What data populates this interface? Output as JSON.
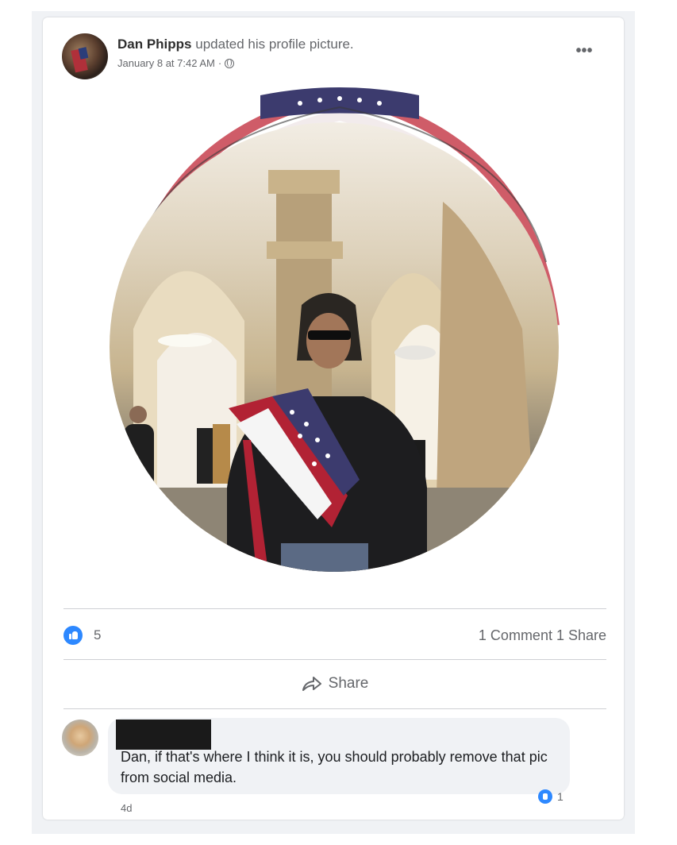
{
  "post": {
    "author_name": "Dan Phipps",
    "action_text": "updated his profile picture.",
    "timestamp": "January 8 at 7:42 AM",
    "separator": "·",
    "privacy_icon": "globe-icon",
    "more_icon": "more-options-icon",
    "more_label": "•••"
  },
  "stats": {
    "reaction_icon": "like-icon",
    "like_count": "5",
    "comments_shares": "1 Comment 1 Share"
  },
  "actions": {
    "share_label": "Share",
    "share_icon": "share-arrow-icon"
  },
  "comment": {
    "text": "Dan, if that's where I think it is, you should probably remove that pic from social media.",
    "reaction_count": "1",
    "time": "4d"
  },
  "colors": {
    "accent": "#2d88ff",
    "secondary_text": "#65676b",
    "bubble": "#f0f2f5",
    "flag_red": "#b22234",
    "flag_blue": "#3c3b6e"
  }
}
